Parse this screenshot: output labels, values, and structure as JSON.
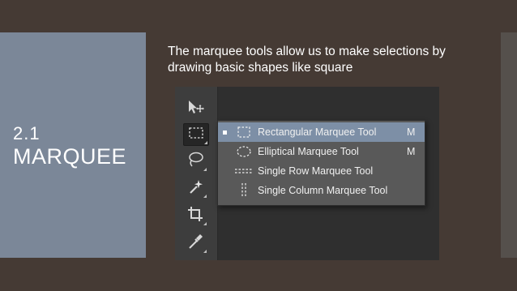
{
  "slide": {
    "number": "2.1",
    "title": "MARQUEE",
    "caption": "The marquee tools allow us to make selections by drawing basic shapes like square"
  },
  "toolbar": {
    "tools": [
      {
        "name": "move-tool",
        "icon": "move-icon",
        "active": false
      },
      {
        "name": "marquee-tool",
        "icon": "rectangular-marquee-icon",
        "active": true
      },
      {
        "name": "lasso-tool",
        "icon": "lasso-icon",
        "active": false
      },
      {
        "name": "magic-wand-tool",
        "icon": "magic-wand-icon",
        "active": false
      },
      {
        "name": "crop-tool",
        "icon": "crop-icon",
        "active": false
      },
      {
        "name": "eyedropper-tool",
        "icon": "eyedropper-icon",
        "active": false
      }
    ]
  },
  "flyout": {
    "items": [
      {
        "label": "Rectangular Marquee Tool",
        "shortcut": "M",
        "selected": true,
        "icon": "rectangular-marquee-icon"
      },
      {
        "label": "Elliptical Marquee Tool",
        "shortcut": "M",
        "selected": false,
        "icon": "elliptical-marquee-icon"
      },
      {
        "label": "Single Row Marquee Tool",
        "shortcut": "",
        "selected": false,
        "icon": "single-row-marquee-icon"
      },
      {
        "label": "Single Column Marquee Tool",
        "shortcut": "",
        "selected": false,
        "icon": "single-column-marquee-icon"
      }
    ]
  },
  "colors": {
    "background": "#453a34",
    "panel": "#7b8798",
    "menu_selected": "#7d8fa6",
    "menu_bg": "#595959"
  }
}
